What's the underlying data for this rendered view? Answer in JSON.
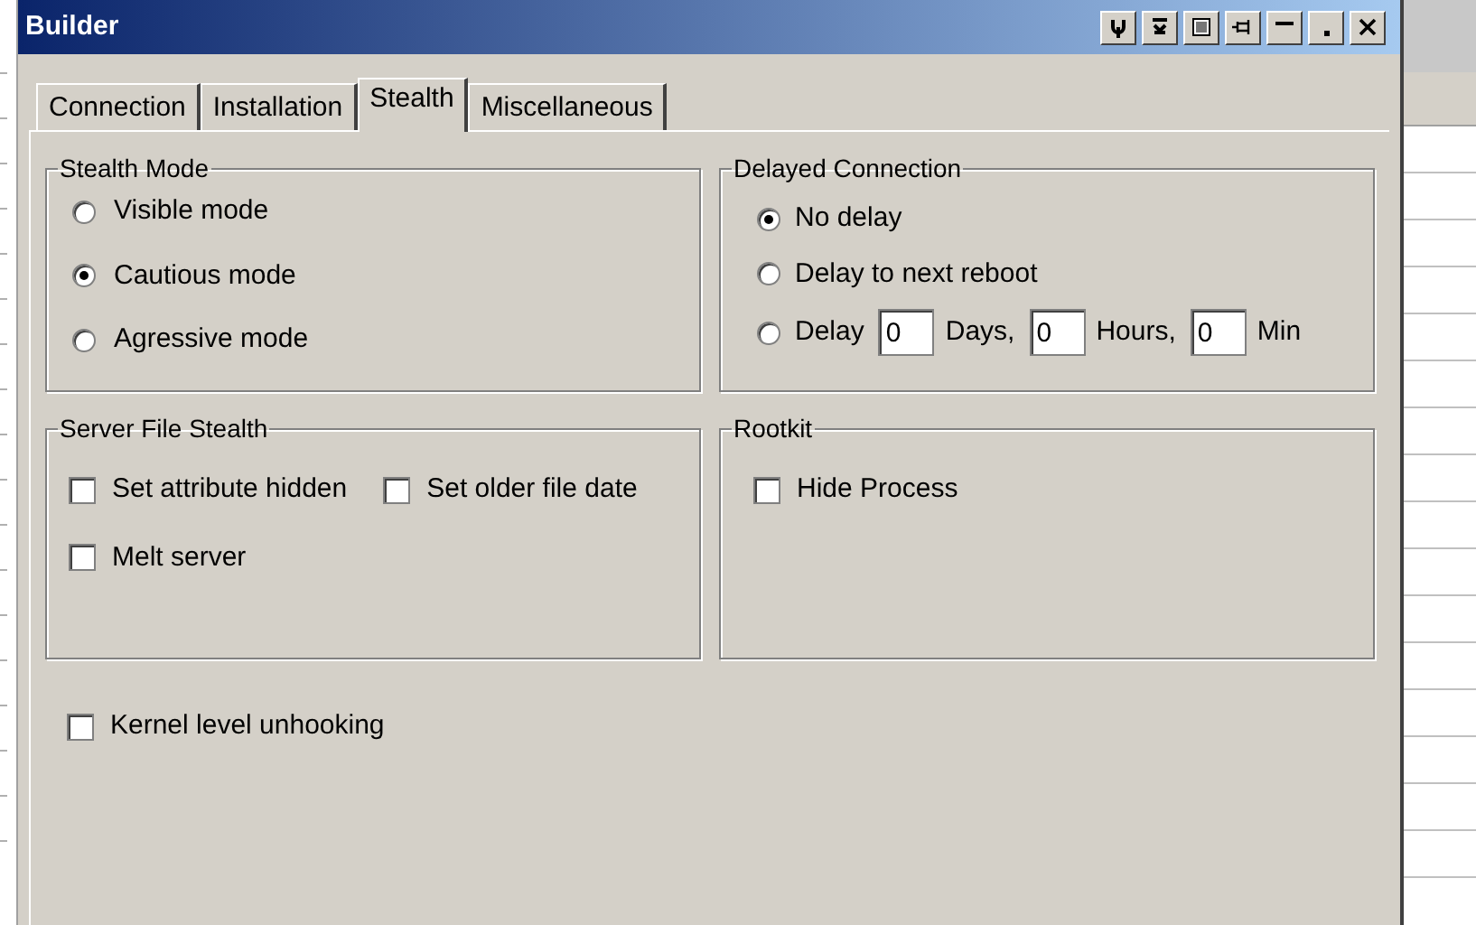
{
  "window": {
    "title": "Builder"
  },
  "tabs": [
    {
      "label": "Connection",
      "selected": false
    },
    {
      "label": "Installation",
      "selected": false
    },
    {
      "label": "Stealth",
      "selected": true
    },
    {
      "label": "Miscellaneous",
      "selected": false
    }
  ],
  "stealth_mode": {
    "title": "Stealth Mode",
    "options": [
      {
        "label": "Visible mode",
        "selected": false
      },
      {
        "label": "Cautious mode",
        "selected": true
      },
      {
        "label": "Agressive mode",
        "selected": false
      }
    ]
  },
  "delayed_connection": {
    "title": "Delayed Connection",
    "options": [
      {
        "kind": "plain",
        "label": "No delay",
        "selected": true
      },
      {
        "kind": "plain",
        "label": "Delay to next reboot",
        "selected": false
      },
      {
        "kind": "delay",
        "label": "Delay",
        "selected": false,
        "fields": [
          {
            "value": "0",
            "unit": "Days,"
          },
          {
            "value": "0",
            "unit": "Hours,"
          },
          {
            "value": "0",
            "unit": "Min"
          }
        ]
      }
    ]
  },
  "server_file_stealth": {
    "title": "Server File Stealth",
    "options": [
      {
        "label": "Set attribute hidden",
        "checked": false
      },
      {
        "label": "Set older file date",
        "checked": false
      },
      {
        "label": "Melt server",
        "checked": false
      }
    ]
  },
  "rootkit": {
    "title": "Rootkit",
    "options": [
      {
        "label": "Hide Process",
        "checked": false
      }
    ]
  },
  "kernel_level_unhooking": {
    "label": "Kernel level unhooking",
    "checked": false
  }
}
